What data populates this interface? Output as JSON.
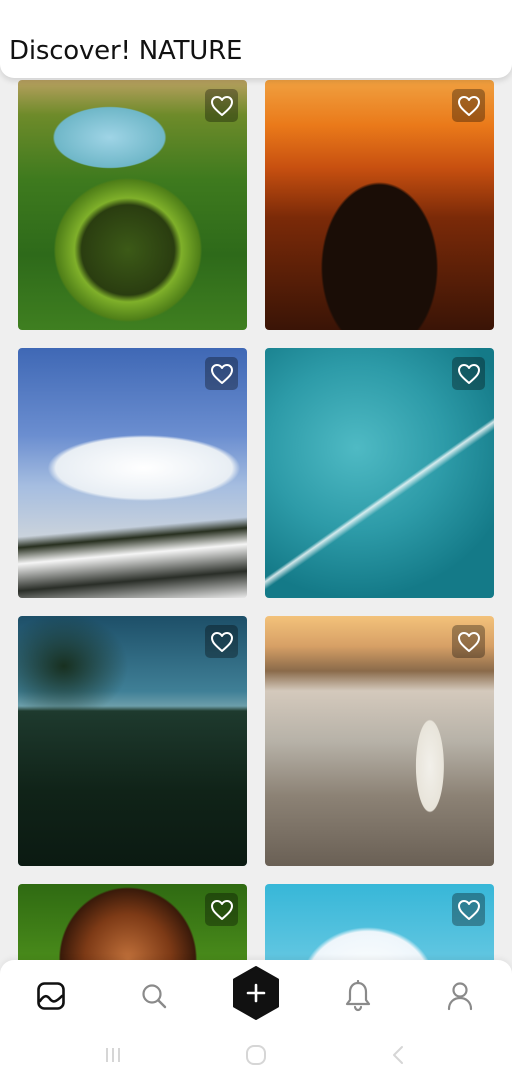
{
  "header": {
    "title": "Discover! NATURE"
  },
  "feed": {
    "tiles": [
      {
        "name": "volcano-crater-photo",
        "icon": "heart-icon"
      },
      {
        "name": "heart-hands-sunset-photo",
        "icon": "heart-icon"
      },
      {
        "name": "snowy-mountains-photo",
        "icon": "heart-icon"
      },
      {
        "name": "airplane-contrail-photo",
        "icon": "heart-icon"
      },
      {
        "name": "night-forest-photo",
        "icon": "heart-icon"
      },
      {
        "name": "woman-on-beach-photo",
        "icon": "heart-icon"
      },
      {
        "name": "mushroom-closeup-photo",
        "icon": "heart-icon"
      },
      {
        "name": "blue-sky-clouds-photo",
        "icon": "heart-icon"
      }
    ]
  },
  "tabbar": {
    "items": [
      {
        "name": "gallery",
        "icon": "image-icon",
        "active": true
      },
      {
        "name": "search",
        "icon": "search-icon",
        "active": false
      },
      {
        "name": "add",
        "icon": "plus-hexagon-icon",
        "active": false
      },
      {
        "name": "notifications",
        "icon": "bell-icon",
        "active": false
      },
      {
        "name": "profile",
        "icon": "user-icon",
        "active": false
      }
    ]
  },
  "colors": {
    "accent": "#111111",
    "background": "#efefef",
    "surface": "#ffffff",
    "icon_inactive": "#8a8a8a"
  }
}
